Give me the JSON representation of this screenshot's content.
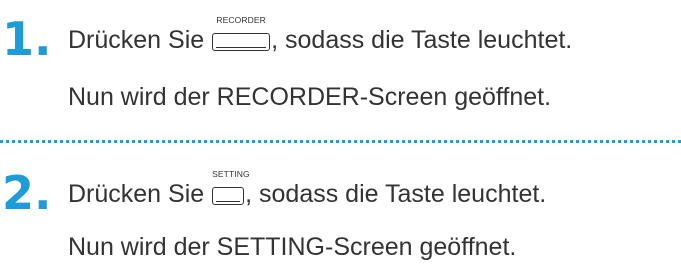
{
  "colors": {
    "accent": "#1e9cd7",
    "text": "#333333"
  },
  "steps": [
    {
      "number": "1.",
      "before": "Drücken Sie ",
      "button_label": "RECORDER",
      "after": ", sodass die Taste leuchtet.",
      "result": "Nun wird der RECORDER-Screen geöffnet."
    },
    {
      "number": "2.",
      "before": "Drücken Sie ",
      "button_label": "SETTING",
      "after": ", sodass die Taste leuchtet.",
      "result": "Nun wird der SETTING-Screen geöffnet."
    }
  ]
}
